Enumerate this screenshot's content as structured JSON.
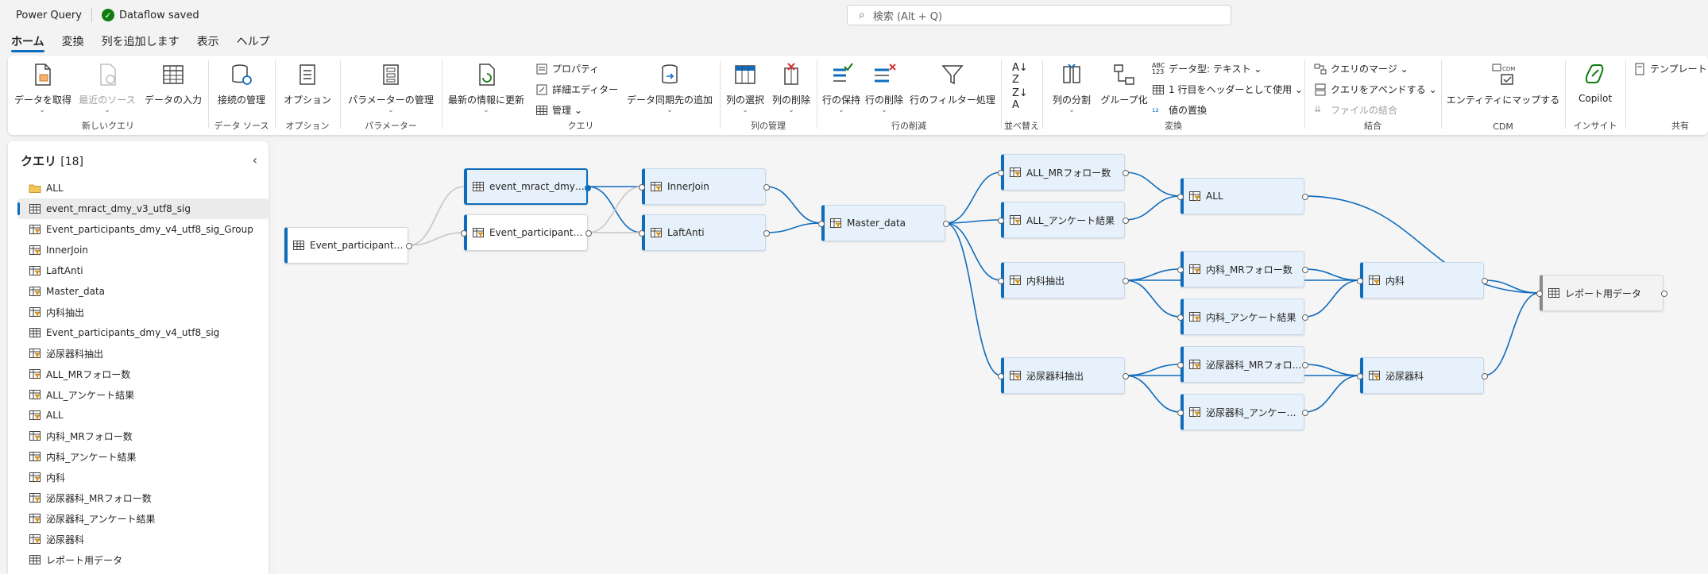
{
  "app": {
    "title": "Power Query",
    "status": "Dataflow saved",
    "search_placeholder": "検索 (Alt + Q)"
  },
  "colors": {
    "accent": "#0f6cbd",
    "saved": "#107c10",
    "node_fill": "#e7f1fb"
  },
  "tabs": [
    {
      "label": "ホーム",
      "active": true
    },
    {
      "label": "変換"
    },
    {
      "label": "列を追加します"
    },
    {
      "label": "表示"
    },
    {
      "label": "ヘルプ"
    }
  ],
  "ribbon": {
    "groups": {
      "new_query": "新しいクエリ",
      "data_source": "データ ソース",
      "options": "オプション",
      "parameters": "パラメーター",
      "query": "クエリ",
      "col_mgmt": "列の管理",
      "row_reduce": "行の削減",
      "sort": "並べ替え",
      "transform": "変換",
      "combine": "結合",
      "cdm": "CDM",
      "insight": "インサイト",
      "share": "共有"
    },
    "buttons": {
      "get_data": "データを取得",
      "recent_sources": "最近のソース",
      "enter_data": "データの入力",
      "manage_connections": "接続の管理",
      "options": "オプション",
      "manage_params": "パラメーターの管理",
      "refresh": "最新の情報に更新",
      "properties": "プロパティ",
      "advanced_editor": "詳細エディター",
      "manage": "管理",
      "add_sync_dest": "データ同期先の追加",
      "choose_cols": "列の選択",
      "remove_cols": "列の削除",
      "keep_rows": "行の保持",
      "remove_rows": "行の削除",
      "filter_rows": "行のフィルター処理",
      "split_col": "列の分割",
      "group_by": "グループ化",
      "data_type": "データ型: テキスト",
      "use_first_row": "1 行目をヘッダーとして使用",
      "replace_values": "値の置換",
      "merge_queries": "クエリのマージ",
      "append_queries": "クエリをアペンドする",
      "combine_files": "ファイルの結合",
      "map_entity": "エンティティにマップする",
      "copilot": "Copilot",
      "template": "テンプレート"
    }
  },
  "queries": {
    "title": "クエリ",
    "count": "[18]",
    "items": [
      {
        "name": "ALL",
        "type": "folder"
      },
      {
        "name": "event_mract_dmy_v3_utf8_sig",
        "type": "table",
        "selected": true
      },
      {
        "name": "Event_participants_dmy_v4_utf8_sig_Group",
        "type": "query"
      },
      {
        "name": "InnerJoin",
        "type": "query"
      },
      {
        "name": "LaftAnti",
        "type": "query"
      },
      {
        "name": "Master_data",
        "type": "query"
      },
      {
        "name": "内科抽出",
        "type": "query"
      },
      {
        "name": "Event_participants_dmy_v4_utf8_sig",
        "type": "table"
      },
      {
        "name": "泌尿器科抽出",
        "type": "query"
      },
      {
        "name": "ALL_MRフォロー数",
        "type": "query"
      },
      {
        "name": "ALL_アンケート結果",
        "type": "query"
      },
      {
        "name": "ALL",
        "type": "query"
      },
      {
        "name": "内科_MRフォロー数",
        "type": "query"
      },
      {
        "name": "内科_アンケート結果",
        "type": "query"
      },
      {
        "name": "内科",
        "type": "query"
      },
      {
        "name": "泌尿器科_MRフォロー数",
        "type": "query"
      },
      {
        "name": "泌尿器科_アンケート結果",
        "type": "query"
      },
      {
        "name": "泌尿器科",
        "type": "query"
      },
      {
        "name": "レポート用データ",
        "type": "table"
      }
    ]
  },
  "diagram": {
    "nodes": {
      "ep_src": "Event_participants_d...",
      "event_mract": "event_mract_dmy_v3_...",
      "ep_group": "Event_participants_d...",
      "innerjoin": "InnerJoin",
      "laftanti": "LaftAnti",
      "master": "Master_data",
      "all_mr": "ALL_MRフォロー数",
      "all_survey": "ALL_アンケート結果",
      "naika_ext": "内科抽出",
      "hinyo_ext": "泌尿器科抽出",
      "all": "ALL",
      "naika_mr": "内科_MRフォロー数",
      "naika_survey": "内科_アンケート結果",
      "hinyo_mr": "泌尿器科_MRフォロ...",
      "hinyo_survey": "泌尿器科_アンケート...",
      "naika": "内科",
      "hinyo": "泌尿器科",
      "report": "レポート用データ"
    }
  }
}
